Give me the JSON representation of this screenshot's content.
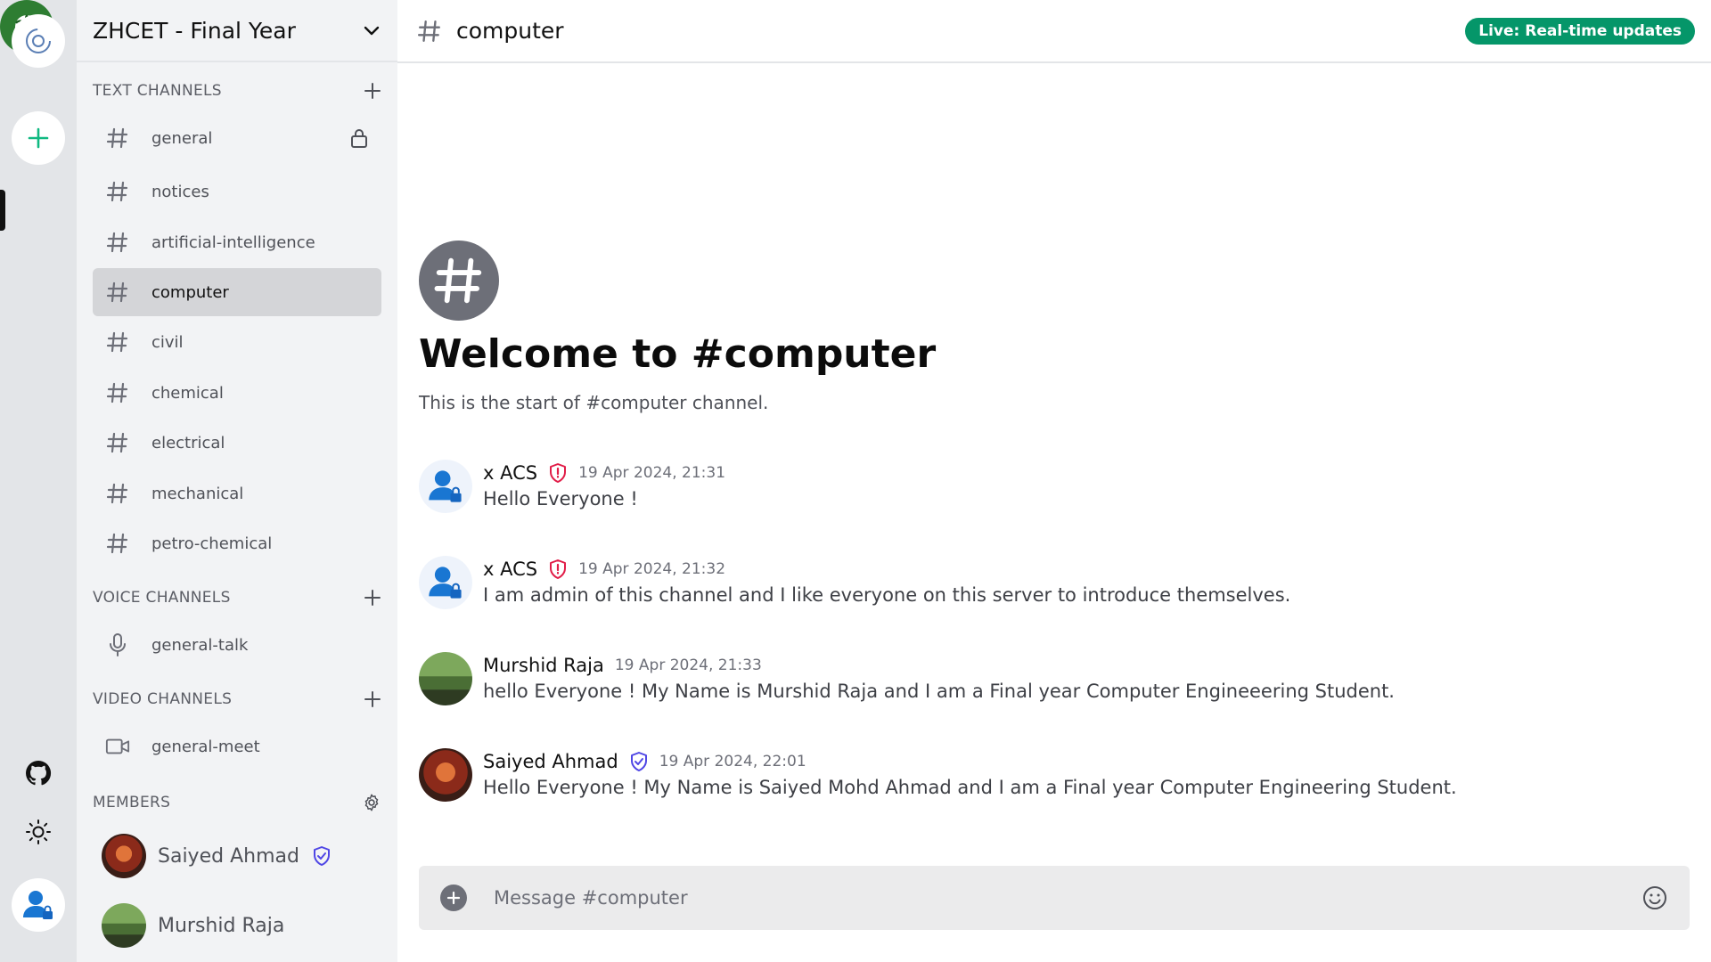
{
  "server": {
    "name": "ZHCET - Final Year"
  },
  "sections": {
    "text": "TEXT CHANNELS",
    "voice": "VOICE CHANNELS",
    "video": "VIDEO CHANNELS",
    "members": "MEMBERS"
  },
  "text_channels": [
    {
      "label": "general",
      "locked": true
    },
    {
      "label": "notices"
    },
    {
      "label": "artificial-intelligence"
    },
    {
      "label": "computer",
      "active": true
    },
    {
      "label": "civil"
    },
    {
      "label": "chemical"
    },
    {
      "label": "electrical"
    },
    {
      "label": "mechanical"
    },
    {
      "label": "petro-chemical"
    }
  ],
  "voice_channels": [
    {
      "label": "general-talk"
    }
  ],
  "video_channels": [
    {
      "label": "general-meet"
    }
  ],
  "members": [
    {
      "name": "Saiyed Ahmad",
      "role": "moderator"
    },
    {
      "name": "Murshid Raja"
    }
  ],
  "header": {
    "channel": "computer",
    "live_badge": "Live: Real-time updates"
  },
  "welcome": {
    "title": "Welcome to #computer",
    "subtitle": "This is the start of #computer channel."
  },
  "messages": [
    {
      "author": "x ACS",
      "role": "admin",
      "time": "19 Apr 2024, 21:31",
      "text": "Hello Everyone !"
    },
    {
      "author": "x ACS",
      "role": "admin",
      "time": "19 Apr 2024, 21:32",
      "text": "I am admin of this channel and I like everyone on this server to introduce themselves."
    },
    {
      "author": "Murshid Raja",
      "time": "19 Apr 2024, 21:33",
      "text": "hello Everyone ! My Name is Murshid Raja and I am a Final year Computer Engineeering Student."
    },
    {
      "author": "Saiyed Ahmad",
      "role": "moderator",
      "time": "19 Apr 2024, 22:01",
      "text": "Hello Everyone ! My Name is Saiyed Mohd Ahmad and I am a Final year Computer Engineering Student."
    }
  ],
  "composer": {
    "placeholder": "Message #computer"
  },
  "colors": {
    "accent_green": "#059669",
    "admin_red": "#e11d48",
    "moderator_indigo": "#4f46e5",
    "add_teal": "#10b981"
  }
}
